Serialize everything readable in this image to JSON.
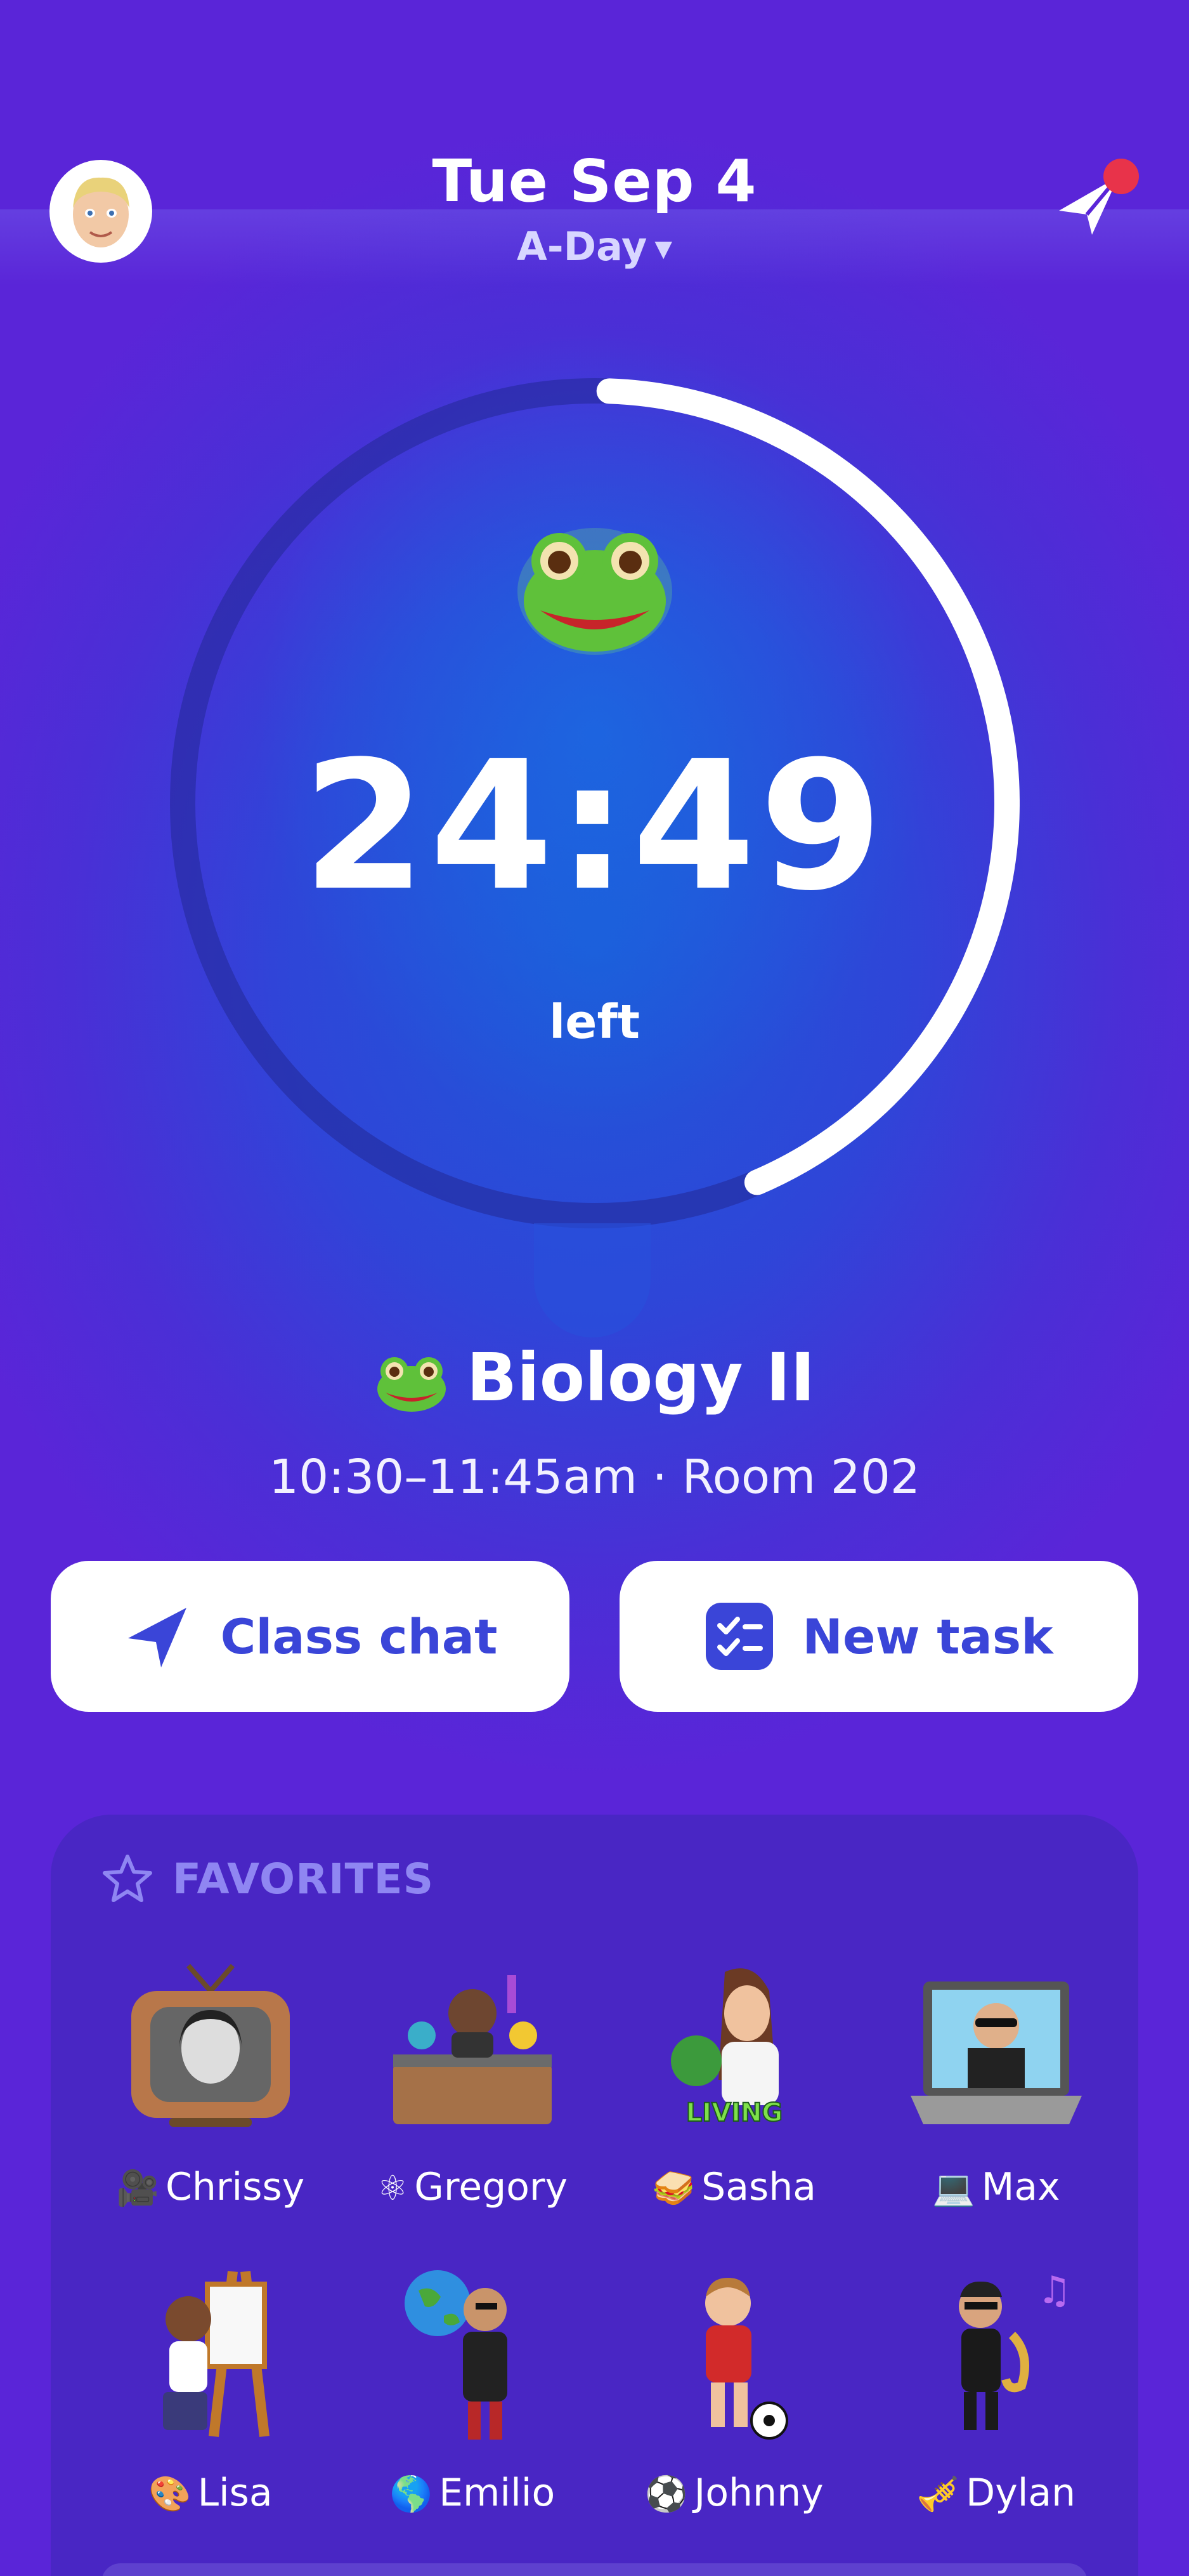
{
  "header": {
    "date": "Tue Sep 4",
    "day_type": "A-Day"
  },
  "timer": {
    "remaining": "24:49",
    "suffix": "left",
    "progress_fraction": 0.43
  },
  "current_class": {
    "emoji": "frog",
    "name": "Biology II",
    "meta": "10:30–11:45am · Room 202"
  },
  "actions": {
    "class_chat_label": "Class chat",
    "new_task_label": "New task"
  },
  "favorites": {
    "title": "FAVORITES",
    "friends": [
      {
        "name": "Chrissy",
        "emoji": "🎥"
      },
      {
        "name": "Gregory",
        "emoji": "⚛"
      },
      {
        "name": "Sasha",
        "emoji": "🥪"
      },
      {
        "name": "Max",
        "emoji": "💻"
      },
      {
        "name": "Lisa",
        "emoji": "🎨"
      },
      {
        "name": "Emilio",
        "emoji": "🌎"
      },
      {
        "name": "Johnny",
        "emoji": "⚽"
      },
      {
        "name": "Dylan",
        "emoji": "🎺"
      }
    ]
  },
  "colors": {
    "accent": "#3a45d8",
    "background_top": "#5a25d8",
    "notification_dot": "#e8334a"
  }
}
